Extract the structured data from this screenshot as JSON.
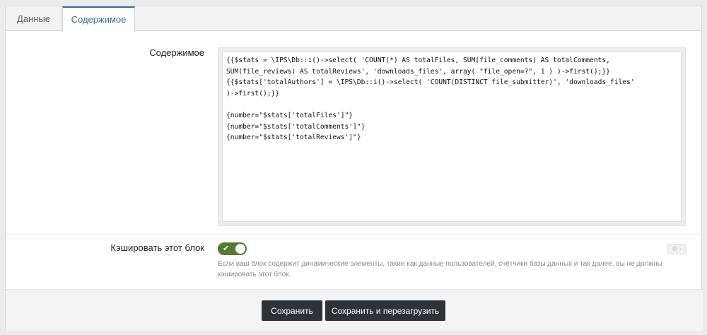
{
  "tabs": [
    {
      "label": "Данные",
      "active": false
    },
    {
      "label": "Содержимое",
      "active": true
    }
  ],
  "content": {
    "label": "Содержимое",
    "code_lines": [
      "{{$stats = \\IPS\\Db::i()->select( 'COUNT(*) AS totalFiles, SUM(file_comments) AS totalComments,",
      "SUM(file_reviews) AS totalReviews', 'downloads_files', array( \"file_open=?\", 1 ) )->first();}}",
      "{{$stats['totalAuthors'] = \\IPS\\Db::i()->select( 'COUNT(DISTINCT file_submitter)', 'downloads_files'",
      ")->first();}}",
      "",
      "{number=\"$stats['totalFiles']\"}",
      "{number=\"$stats['totalComments']\"}",
      "{number=\"$stats['totalReviews']\"}"
    ]
  },
  "cache": {
    "label": "Кэшировать этот блок",
    "enabled": true,
    "description": "Если ваш блок содержит динамические элементы, такие как данные пользователей, счётчики базы данных и так далее, вы не должны кэшировать этот блок."
  },
  "footer": {
    "save_label": "Сохранить",
    "save_reload_label": "Сохранить и перезагрузить"
  },
  "colors": {
    "accent": "#3b6b96",
    "toggle_on": "#537a2f",
    "button_dark": "#2d3339"
  },
  "icons": {
    "toggle_check": "check-icon",
    "settings": "gear-icon"
  }
}
